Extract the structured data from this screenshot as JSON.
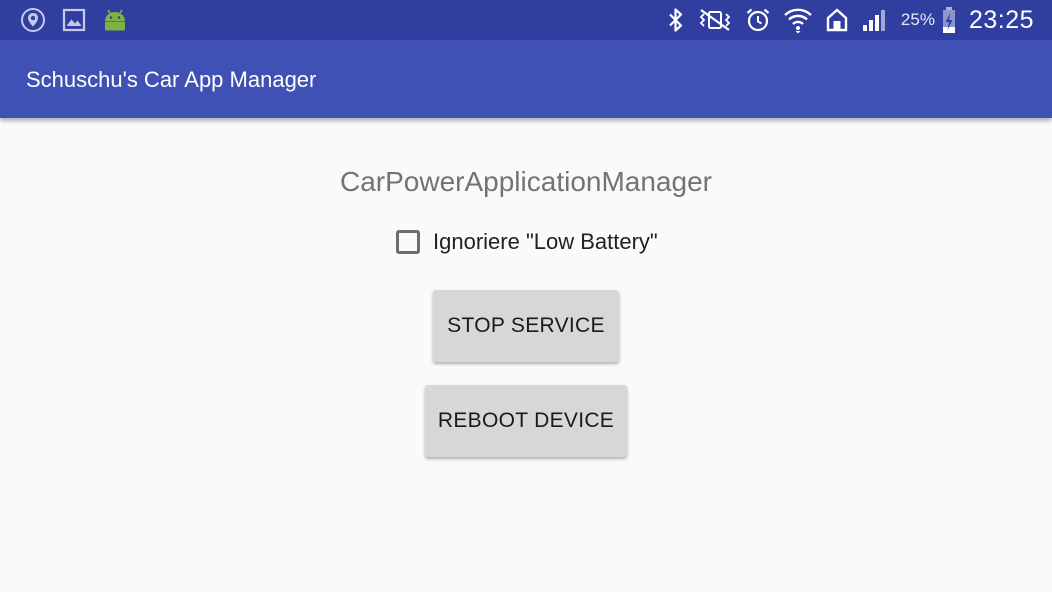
{
  "status_bar": {
    "left_icons": [
      "shield-location-icon",
      "image-icon",
      "android-icon"
    ],
    "right_icons": [
      "bluetooth-icon",
      "vibrate-mute-icon",
      "alarm-icon",
      "wifi-icon",
      "home-icon",
      "signal-icon",
      "battery-charging-icon"
    ],
    "battery_percent": "25%",
    "time": "23:25"
  },
  "app_bar": {
    "title": "Schuschu's Car App Manager"
  },
  "main": {
    "heading": "CarPowerApplicationManager",
    "checkbox": {
      "label": "Ignoriere \"Low Battery\"",
      "checked": false
    },
    "buttons": {
      "stop_service": "STOP SERVICE",
      "reboot_device": "REBOOT DEVICE"
    }
  },
  "colors": {
    "status_bar": "#303f9f",
    "app_bar": "#3f51b5",
    "background": "#fafafa",
    "button": "#d6d7d7",
    "heading_text": "#737373"
  }
}
